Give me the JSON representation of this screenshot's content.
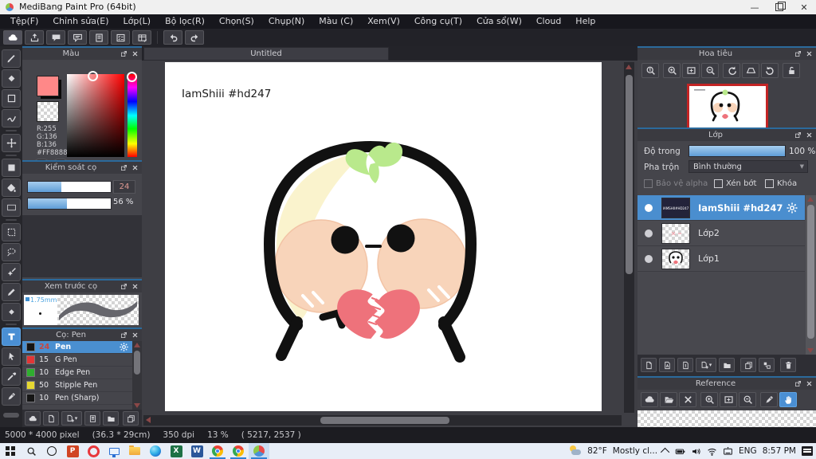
{
  "window": {
    "title": "MediBang Paint Pro (64bit)",
    "close_glyph": "✕",
    "minimize_glyph": "—"
  },
  "menu_bar": {
    "items": [
      "Tệp(F)",
      "Chỉnh sửa(E)",
      "Lớp(L)",
      "Bộ lọc(R)",
      "Chọn(S)",
      "Chụp(N)",
      "Màu (C)",
      "Xem(V)",
      "Công cụ(T)",
      "Cửa sổ(W)",
      "Cloud",
      "Help"
    ]
  },
  "toolbar_icons": [
    "cloud-save",
    "export",
    "comment",
    "comment-list",
    "document",
    "checklist",
    "material-table",
    "undo",
    "redo"
  ],
  "tools_column": [
    "brush",
    "eraser",
    "shape",
    "curve-snap",
    "move",
    "fill-shape",
    "bucket-fill",
    "gradient",
    "select-rect",
    "lasso",
    "magic-wand",
    "select-pen",
    "select-eraser",
    "text",
    "operation",
    "eyedropper",
    "pen"
  ],
  "active_tool": "text",
  "color_panel": {
    "title": "Màu",
    "r_label": "R:255",
    "g_label": "G:136",
    "b_label": "B:136",
    "hex_label": "#FF8888",
    "foreground_color": "#FF8888"
  },
  "brush_control_panel": {
    "title": "Kiểm soát cọ",
    "size_value": "24",
    "opacity_value": "56 %"
  },
  "brush_preview_panel": {
    "title": "Xem trước cọ",
    "width_label": "1.75mm"
  },
  "brush_panel": {
    "title": "Cọ: Pen",
    "brushes": [
      {
        "size": "24",
        "name": "Pen",
        "swatch": "#151515",
        "selected": true
      },
      {
        "size": "15",
        "name": "G Pen",
        "swatch": "#e23636"
      },
      {
        "size": "10",
        "name": "Edge Pen",
        "swatch": "#2fae2f"
      },
      {
        "size": "50",
        "name": "Stipple Pen",
        "swatch": "#e6d832"
      },
      {
        "size": "10",
        "name": "Pen (Sharp)",
        "swatch": "#151515"
      }
    ]
  },
  "canvas": {
    "tab_title": "Untitled",
    "signature": "IamShiii #hd247"
  },
  "navigator_panel": {
    "title": "Hoa tiêu",
    "buttons": [
      "zoom-actual",
      "zoom-in",
      "fit-screen",
      "zoom-out",
      "rotate-ccw",
      "reset-view",
      "rotate-cw",
      "unlock"
    ]
  },
  "layers_panel": {
    "title": "Lớp",
    "opacity_label": "Độ trong",
    "opacity_value": "100 %",
    "blend_label": "Pha trộn",
    "blend_mode": "Bình thường",
    "alpha_lock_label": "Bảo vệ alpha",
    "clipping_label": "Xén bớt",
    "lock_label": "Khóa",
    "layers": [
      {
        "name": "IamShiii #hd247",
        "selected": true
      },
      {
        "name": "Lớp2",
        "selected": false
      },
      {
        "name": "Lớp1",
        "selected": false
      }
    ],
    "buttons": [
      "new-layer",
      "new-halftone-layer",
      "new-1bit-layer",
      "add-layer-menu",
      "new-folder",
      "duplicate-layer",
      "merge-layer",
      "delete-layer"
    ]
  },
  "reference_panel": {
    "title": "Reference",
    "buttons": [
      "cloud-import",
      "open-file",
      "clear",
      "zoom-in",
      "fit-screen",
      "zoom-out",
      "eyedropper",
      "hand"
    ]
  },
  "status_bar": {
    "document_size": "5000 * 4000 pixel",
    "physical_size": "(36.3 * 29cm)",
    "resolution": "350 dpi",
    "zoom_level": "13 %",
    "cursor_position": "( 5217, 2537 )"
  },
  "taskbar": {
    "apps": [
      "start",
      "search",
      "cortana",
      "powerpoint",
      "opera",
      "display",
      "file-explorer",
      "edge",
      "excel",
      "word",
      "chrome",
      "chrome-2",
      "medibang-paint"
    ],
    "app_glyphs": {
      "powerpoint": "P",
      "excel": "X",
      "word": "W"
    },
    "weather": "82°F",
    "weather_desc": "Mostly cl...",
    "language": "ENG",
    "time": "8:57 PM"
  },
  "colors": {
    "accent_blue": "#4a8fd0",
    "selected_layer": "#4a8ecf",
    "panel_bg": "#45454b",
    "foreground_color": "#FF8888",
    "navigator_border": "#c32424"
  }
}
